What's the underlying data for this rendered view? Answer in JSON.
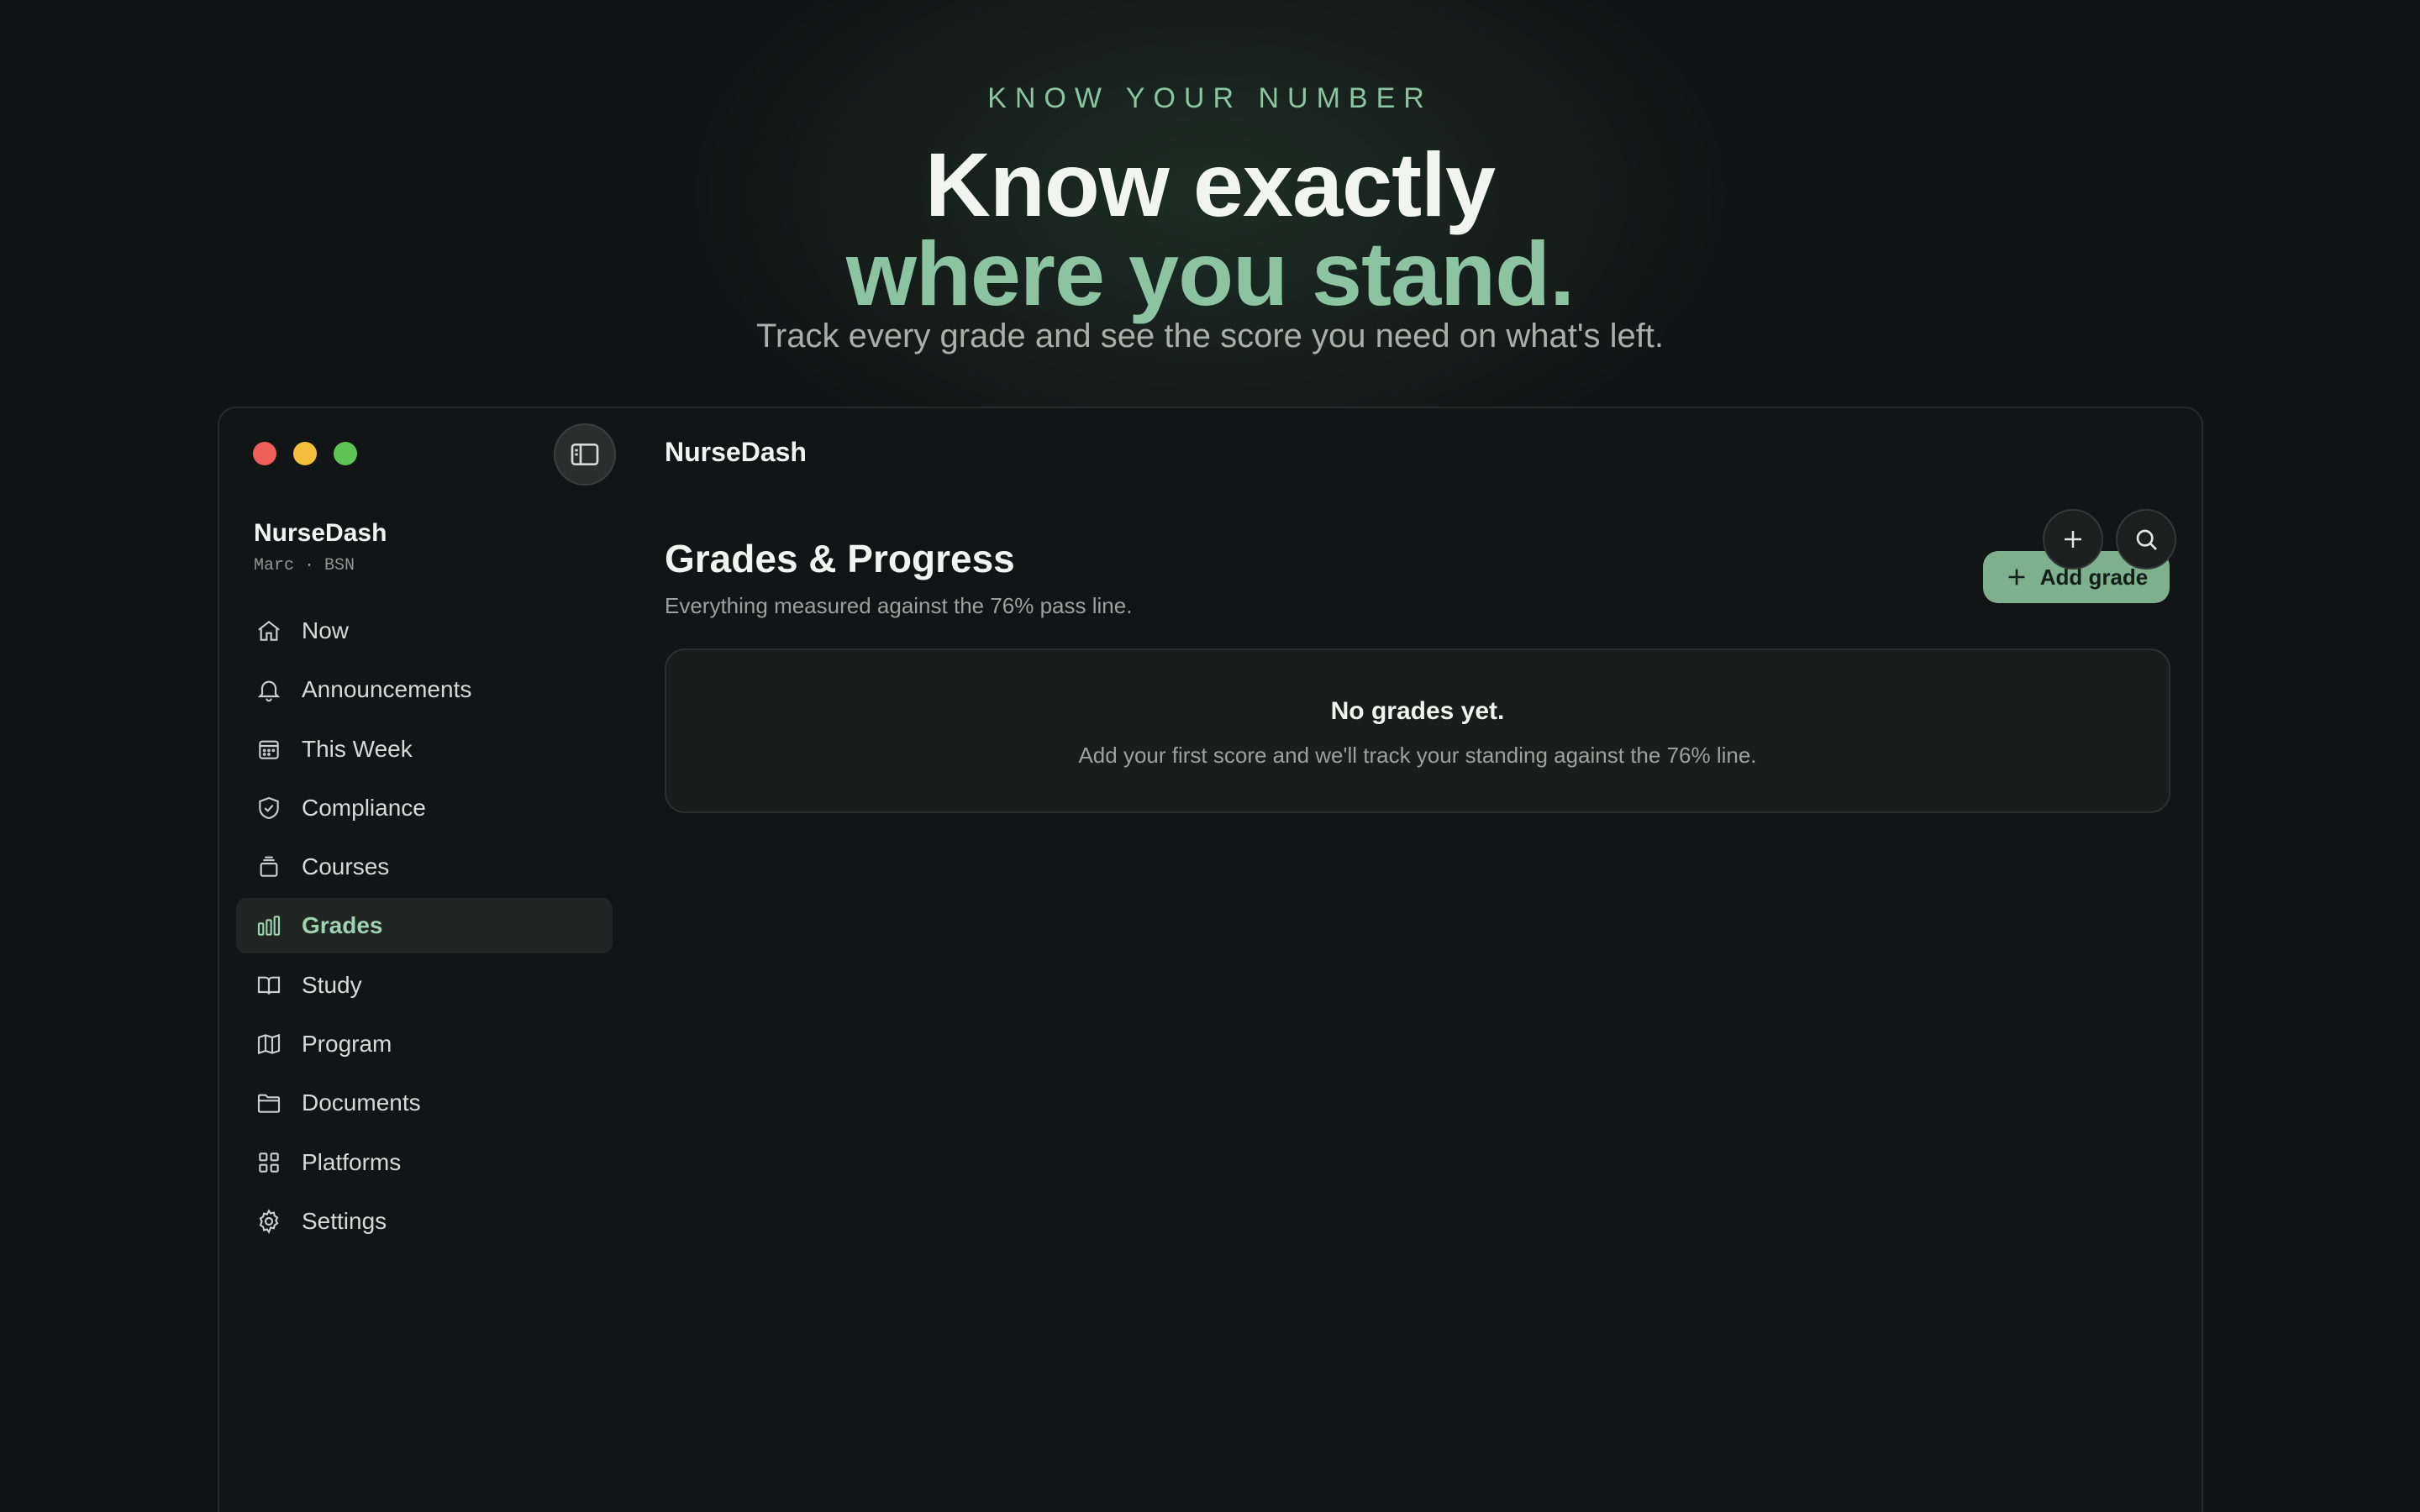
{
  "hero": {
    "eyebrow": "KNOW YOUR NUMBER",
    "headline_line1": "Know exactly",
    "headline_line2": "where you stand.",
    "subhead": "Track every grade and see the score you need on what's left."
  },
  "window": {
    "title": "NurseDash",
    "traffic_lights": [
      "#ee5f57",
      "#f4be3c",
      "#5fc454"
    ]
  },
  "sidebar": {
    "brand": "NurseDash",
    "user": "Marc · BSN",
    "items": [
      {
        "label": "Now",
        "icon": "home-icon"
      },
      {
        "label": "Announcements",
        "icon": "bell-icon"
      },
      {
        "label": "This Week",
        "icon": "calendar-icon"
      },
      {
        "label": "Compliance",
        "icon": "shield-check-icon"
      },
      {
        "label": "Courses",
        "icon": "layers-icon"
      },
      {
        "label": "Grades",
        "icon": "bar-chart-icon",
        "active": true
      },
      {
        "label": "Study",
        "icon": "book-open-icon"
      },
      {
        "label": "Program",
        "icon": "map-icon"
      },
      {
        "label": "Documents",
        "icon": "folder-icon"
      },
      {
        "label": "Platforms",
        "icon": "grid-icon"
      },
      {
        "label": "Settings",
        "icon": "gear-icon"
      }
    ]
  },
  "main": {
    "page_title": "Grades & Progress",
    "page_subtitle": "Everything measured against the 76% pass line.",
    "add_grade_label": "Add grade",
    "empty": {
      "title": "No grades yet.",
      "body": "Add your first score and we'll track your standing against the 76% line."
    }
  },
  "colors": {
    "accent": "#8cc3a0",
    "button_bg": "#7fb08e",
    "background": "#111414"
  }
}
